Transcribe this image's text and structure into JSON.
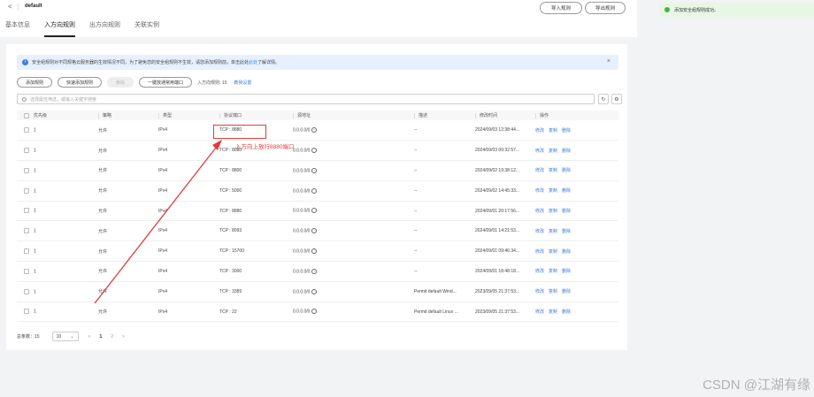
{
  "header": {
    "back_label": "<",
    "title": "default",
    "import_label": "导入规则",
    "export_label": "导出规则",
    "tabs": [
      {
        "label": "基本信息"
      },
      {
        "label": "入方向规则"
      },
      {
        "label": "出方向规则"
      },
      {
        "label": "关联实例"
      }
    ]
  },
  "info": {
    "text": "安全组规则对不同规格云服务器的生效情况不同，为了避免您的安全组规则不生效，请您添加规则前，单击此处",
    "link": "此处",
    "text_after": "了解详情。",
    "close": "×"
  },
  "toolbar": {
    "add_rule": "添加规则",
    "quick_add": "快速添加规则",
    "delete": "删除",
    "open_ports": "一键放通常用端口",
    "count_label": "入方向规则: 15",
    "guide_link": "教我设置"
  },
  "search": {
    "placeholder": "选择属性筛选，或输入关键字搜索"
  },
  "table": {
    "headers": [
      "优先级",
      "策略",
      "类型",
      "协议端口",
      "源地址",
      "描述",
      "修改时间",
      "操作"
    ],
    "rows": [
      {
        "priority": "1",
        "policy": "允许",
        "type": "IPv4",
        "port": "TCP : 8880",
        "source": "0.0.0.0/0",
        "desc": "--",
        "time": "2024/09/03 12:38:44...",
        "ops": [
          "修改",
          "复制",
          "删除"
        ]
      },
      {
        "priority": "1",
        "policy": "允许",
        "type": "IPv4",
        "port": "TCP : 8080",
        "source": "0.0.0.0/0",
        "desc": "--",
        "time": "2024/09/03 00:32:57...",
        "ops": [
          "修改",
          "复制",
          "删除"
        ]
      },
      {
        "priority": "1",
        "policy": "允许",
        "type": "IPv4",
        "port": "TCP : 8800",
        "source": "0.0.0.0/0",
        "desc": "--",
        "time": "2024/09/02 19:38:12...",
        "ops": [
          "修改",
          "复制",
          "删除"
        ]
      },
      {
        "priority": "1",
        "policy": "允许",
        "type": "IPv4",
        "port": "TCP : 5000",
        "source": "0.0.0.0/0",
        "desc": "--",
        "time": "2024/09/02 14:45:33...",
        "ops": [
          "修改",
          "复制",
          "删除"
        ]
      },
      {
        "priority": "1",
        "policy": "允许",
        "type": "IPv4",
        "port": "TCP : 8880",
        "source": "0.0.0.0/0",
        "desc": "--",
        "time": "2024/09/01 20:17:56...",
        "ops": [
          "修改",
          "复制",
          "删除"
        ]
      },
      {
        "priority": "1",
        "policy": "允许",
        "type": "IPv4",
        "port": "TCP : 8093",
        "source": "0.0.0.0/0",
        "desc": "--",
        "time": "2024/09/01 14:21:53...",
        "ops": [
          "修改",
          "复制",
          "删除"
        ]
      },
      {
        "priority": "1",
        "policy": "允许",
        "type": "IPv4",
        "port": "TCP : 15700",
        "source": "0.0.0.0/0",
        "desc": "--",
        "time": "2024/09/01 09:46:34...",
        "ops": [
          "修改",
          "复制",
          "删除"
        ]
      },
      {
        "priority": "1",
        "policy": "允许",
        "type": "IPv4",
        "port": "TCP : 3000",
        "source": "0.0.0.0/0",
        "desc": "--",
        "time": "2024/09/01 18:48:18...",
        "ops": [
          "修改",
          "复制",
          "删除"
        ]
      },
      {
        "priority": "1",
        "policy": "允许",
        "type": "IPv4",
        "port": "TCP : 3389",
        "source": "0.0.0.0/0",
        "desc": "Permit default Wind...",
        "time": "2023/09/05 21:37:53...",
        "ops": [
          "修改",
          "复制",
          "删除"
        ]
      },
      {
        "priority": "1",
        "policy": "允许",
        "type": "IPv4",
        "port": "TCP : 22",
        "source": "0.0.0.0/0",
        "desc": "Permit default Linux ...",
        "time": "2023/09/05 21:37:53...",
        "ops": [
          "修改",
          "复制",
          "删除"
        ]
      }
    ]
  },
  "pager": {
    "total_label": "总条数：15",
    "page_size": "10",
    "prev": "<",
    "next": ">",
    "pages": [
      "1",
      "2"
    ]
  },
  "annotation": {
    "text": "入方向上放行8880端口"
  },
  "toast": {
    "text": "添加安全组规则成功。"
  },
  "watermark": "CSDN @江湖有缘",
  "colors": {
    "link": "#3b7ddd",
    "annotation": "#e03c3c",
    "success": "#46b34b"
  }
}
